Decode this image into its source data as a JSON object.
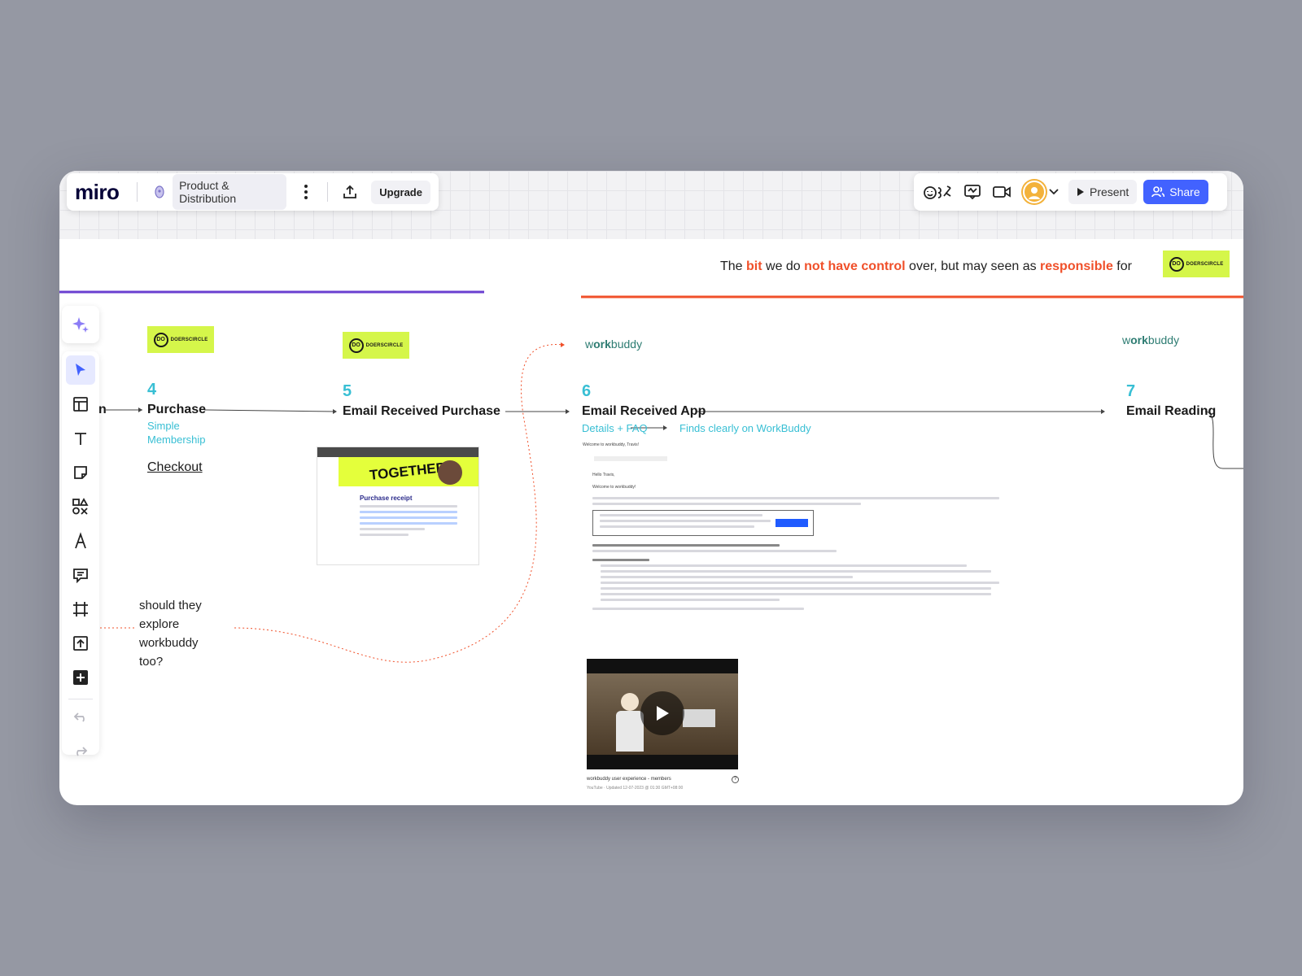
{
  "app": {
    "logo": "miro",
    "board_name": "Product & Distribution",
    "upgrade_label": "Upgrade",
    "present_label": "Present",
    "share_label": "Share"
  },
  "banner": {
    "part1": "The ",
    "bit": "bit",
    "part2": " we do ",
    "nohave": "not have control",
    "part3": " over, but may seen as ",
    "resp": "responsible",
    "part4": " for"
  },
  "logos": {
    "doers_mark": "DO",
    "doers_text": "DOERSCIRCLE",
    "workbuddy_pre": "w",
    "workbuddy_b": "ork",
    "workbuddy_post": "buddy"
  },
  "steps": [
    {
      "num": "4",
      "title": "Purchase",
      "sub1": "Simple",
      "sub2": "Membership",
      "link": "Checkout"
    },
    {
      "num": "5",
      "title": "Email Received Purchase"
    },
    {
      "num": "6",
      "title": "Email Received App",
      "sub1": "Details + FAQ",
      "sub2": "Finds clearly on WorkBuddy"
    },
    {
      "num": "7",
      "title": "Email Reading"
    }
  ],
  "clipped_prev_title": "n",
  "note": [
    "should they",
    "explore",
    "workbuddy",
    "too?"
  ],
  "receipt": {
    "hero": "TOGETHER",
    "title": "Purchase receipt"
  },
  "email": {
    "subject": "Welcome to workbuddy, Travis!",
    "greeting": "Hello Travis,",
    "welcome": "Welcome to workbuddy!",
    "video_title": "workbuddy user experience - members",
    "video_meta": "YouTube · Updated 12-07-2023 @ 01:30 GMT+08:00"
  },
  "colors": {
    "accent_blue": "#4262ff",
    "cyan": "#38bfd4",
    "orange": "#f0502a",
    "purple": "#6a3fd0",
    "lime": "#d5f64a"
  }
}
